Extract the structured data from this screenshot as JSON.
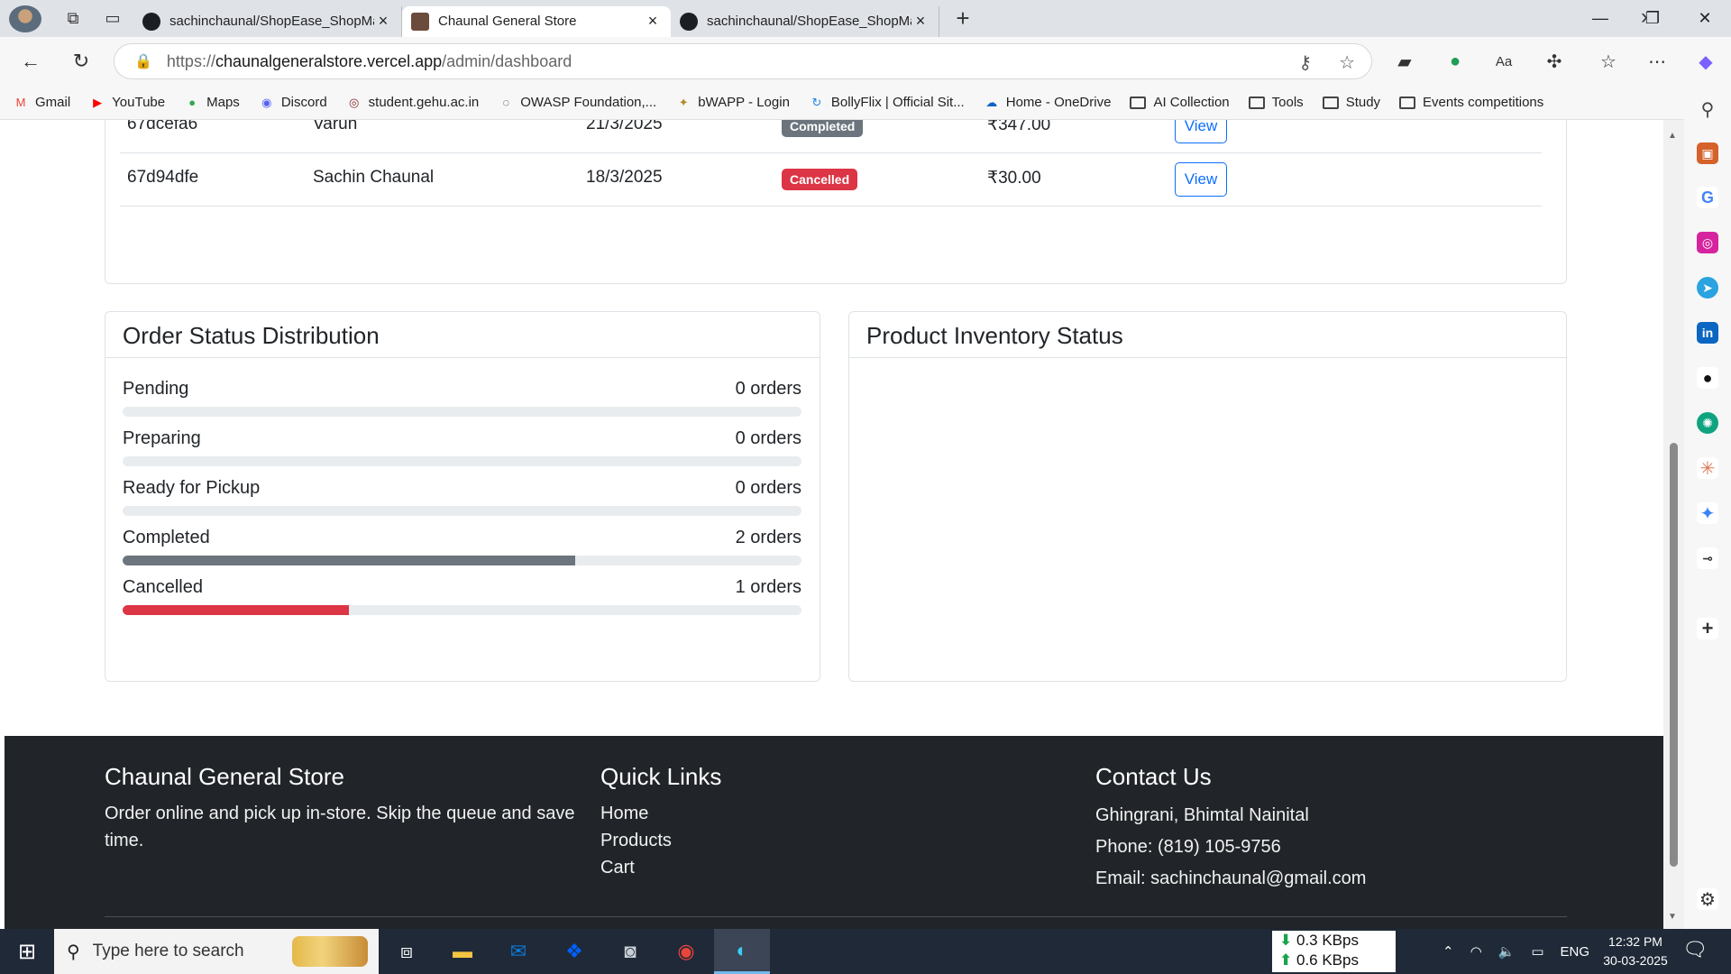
{
  "browser": {
    "tabs": [
      {
        "title": "sachinchaunal/ShopEase_ShopMa",
        "active": false
      },
      {
        "title": "Chaunal General Store",
        "active": true
      },
      {
        "title": "sachinchaunal/ShopEase_ShopMa",
        "active": false
      }
    ],
    "new_tab": "+",
    "url_prefix": "https://",
    "url_host": "chaunalgeneralstore.vercel.app",
    "url_path": "/admin/dashboard",
    "window": {
      "minimize": "—",
      "maximize": "❐",
      "close": "✕"
    }
  },
  "bookmarks": [
    {
      "label": "Gmail",
      "icon": "gmail-icon",
      "color": "#ea4335",
      "glyph": "M"
    },
    {
      "label": "YouTube",
      "icon": "youtube-icon",
      "color": "#ff0000",
      "glyph": "▶"
    },
    {
      "label": "Maps",
      "icon": "maps-icon",
      "color": "#34a853",
      "glyph": "●"
    },
    {
      "label": "Discord",
      "icon": "discord-icon",
      "color": "#5865f2",
      "glyph": "◉"
    },
    {
      "label": "student.gehu.ac.in",
      "icon": "gehu-icon",
      "color": "#8b2b2b",
      "glyph": "◎"
    },
    {
      "label": "OWASP Foundation,...",
      "icon": "owasp-icon",
      "color": "#222222",
      "glyph": "◌"
    },
    {
      "label": "bWAPP - Login",
      "icon": "bwapp-icon",
      "color": "#b5892c",
      "glyph": "✦"
    },
    {
      "label": "BollyFlix | Official Sit...",
      "icon": "bollyflix-icon",
      "color": "#1e88e5",
      "glyph": "↻"
    },
    {
      "label": "Home - OneDrive",
      "icon": "onedrive-icon",
      "color": "#0a64c8",
      "glyph": "☁"
    },
    {
      "label": "AI Collection",
      "icon": "folder-icon",
      "folder": true
    },
    {
      "label": "Tools",
      "icon": "folder-icon",
      "folder": true
    },
    {
      "label": "Study",
      "icon": "folder-icon",
      "folder": true
    },
    {
      "label": "Events competitions",
      "icon": "folder-icon",
      "folder": true
    }
  ],
  "orders": {
    "rows": [
      {
        "id": "67dcefa6",
        "customer": "Varun",
        "date": "21/3/2025",
        "status": "Completed",
        "status_type": "completed",
        "amount": "₹347.00",
        "action": "View"
      },
      {
        "id": "67d94dfe",
        "customer": "Sachin Chaunal",
        "date": "18/3/2025",
        "status": "Cancelled",
        "status_type": "cancelled",
        "amount": "₹30.00",
        "action": "View"
      }
    ]
  },
  "status_distribution": {
    "title": "Order Status Distribution",
    "items": [
      {
        "label": "Pending",
        "count": "0 orders",
        "fraction": 0,
        "color": "#e9ecef"
      },
      {
        "label": "Preparing",
        "count": "0 orders",
        "fraction": 0,
        "color": "#e9ecef"
      },
      {
        "label": "Ready for Pickup",
        "count": "0 orders",
        "fraction": 0,
        "color": "#e9ecef"
      },
      {
        "label": "Completed",
        "count": "2 orders",
        "fraction": 0.667,
        "color": "#6c757d"
      },
      {
        "label": "Cancelled",
        "count": "1 orders",
        "fraction": 0.333,
        "color": "#dc3545"
      }
    ]
  },
  "inventory": {
    "title": "Product Inventory Status"
  },
  "footer": {
    "brand": "Chaunal General Store",
    "tagline": "Order online and pick up in-store. Skip the queue and save time.",
    "links_title": "Quick Links",
    "links": [
      "Home",
      "Products",
      "Cart"
    ],
    "contact_title": "Contact Us",
    "address": "Ghingrani, Bhimtal Nainital",
    "phone": "Phone: (819) 105-9756",
    "email": "Email: sachinchaunal@gmail.com"
  },
  "taskbar": {
    "search_placeholder": "Type here to search",
    "net_down": "0.3 KBps",
    "net_up": "0.6 KBps",
    "language": "ENG",
    "time": "12:32 PM",
    "date": "30-03-2025"
  },
  "colors": {
    "completed": "#6c757d",
    "cancelled": "#dc3545",
    "primary": "#0d6efd",
    "footer_bg": "#212529"
  }
}
